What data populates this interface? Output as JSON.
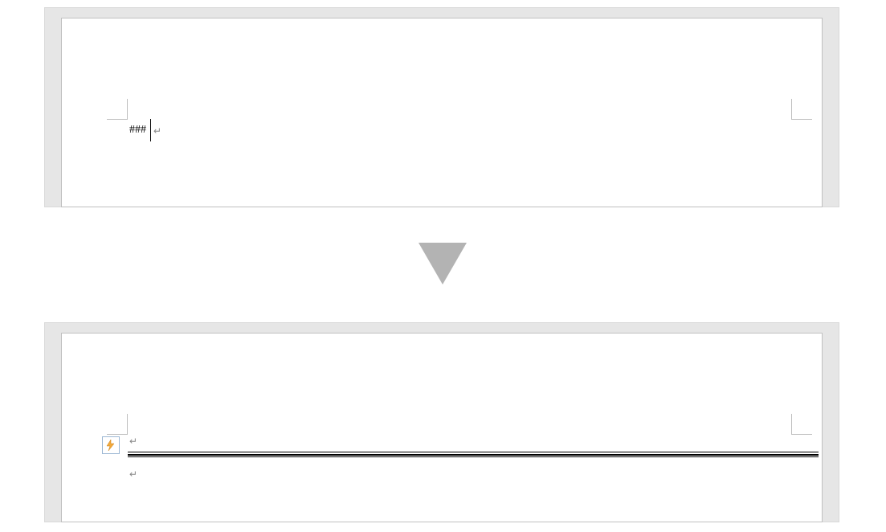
{
  "before": {
    "typed": "###",
    "paragraph_mark": "↵"
  },
  "after": {
    "line1_mark": "↵",
    "line2_mark": "↵",
    "autocorrect_icon": "autocorrect-options-icon"
  }
}
